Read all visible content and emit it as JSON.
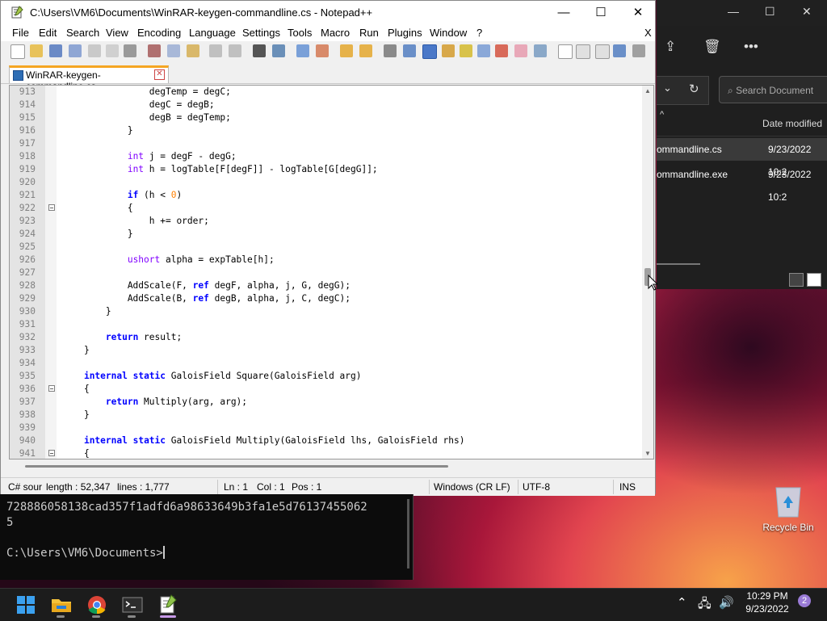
{
  "window": {
    "title": "C:\\Users\\VM6\\Documents\\WinRAR-keygen-commandline.cs - Notepad++",
    "minimize": "—",
    "maximize": "☐",
    "close": "✕",
    "menu_close": "X"
  },
  "menu": [
    "File",
    "Edit",
    "Search",
    "View",
    "Encoding",
    "Language",
    "Settings",
    "Tools",
    "Macro",
    "Run",
    "Plugins",
    "Window",
    "?"
  ],
  "tab": {
    "label": "WinRAR-keygen-commandline.cs"
  },
  "code_lines": [
    {
      "n": "913",
      "t": "                degTemp = degC;"
    },
    {
      "n": "914",
      "t": "                degC = degB;"
    },
    {
      "n": "915",
      "t": "                degB = degTemp;"
    },
    {
      "n": "916",
      "t": "            }"
    },
    {
      "n": "917",
      "t": ""
    },
    {
      "n": "918",
      "t": "            int j = degF - degG;"
    },
    {
      "n": "919",
      "t": "            int h = logTable[F[degF]] - logTable[G[degG]];"
    },
    {
      "n": "920",
      "t": ""
    },
    {
      "n": "921",
      "t": "            if (h < 0)"
    },
    {
      "n": "922",
      "t": "            {"
    },
    {
      "n": "923",
      "t": "                h += order;"
    },
    {
      "n": "924",
      "t": "            }"
    },
    {
      "n": "925",
      "t": ""
    },
    {
      "n": "926",
      "t": "            ushort alpha = expTable[h];"
    },
    {
      "n": "927",
      "t": ""
    },
    {
      "n": "928",
      "t": "            AddScale(F, ref degF, alpha, j, G, degG);"
    },
    {
      "n": "929",
      "t": "            AddScale(B, ref degB, alpha, j, C, degC);"
    },
    {
      "n": "930",
      "t": "        }"
    },
    {
      "n": "931",
      "t": ""
    },
    {
      "n": "932",
      "t": "        return result;"
    },
    {
      "n": "933",
      "t": "    }"
    },
    {
      "n": "934",
      "t": ""
    },
    {
      "n": "935",
      "t": "    internal static GaloisField Square(GaloisField arg)"
    },
    {
      "n": "936",
      "t": "    {"
    },
    {
      "n": "937",
      "t": "        return Multiply(arg, arg);"
    },
    {
      "n": "938",
      "t": "    }"
    },
    {
      "n": "939",
      "t": ""
    },
    {
      "n": "940",
      "t": "    internal static GaloisField Multiply(GaloisField lhs, GaloisField rhs)"
    },
    {
      "n": "941",
      "t": "    {"
    }
  ],
  "fold_lines": [
    "922",
    "936",
    "941"
  ],
  "status": {
    "lang": "C# sour",
    "length": "length : 52,347",
    "lines": "lines : 1,777",
    "ln": "Ln : 1",
    "col": "Col : 1",
    "pos": "Pos : 1",
    "eol": "Windows (CR LF)",
    "enc": "UTF-8",
    "mode": "INS"
  },
  "terminal": {
    "line1": "728886058138cad357f1adfd6a98633649b3fa1e5d76137455062",
    "line2": "5",
    "prompt": "C:\\Users\\VM6\\Documents>"
  },
  "explorer": {
    "search_placeholder": "Search Document",
    "col_date": "Date modified",
    "files": [
      {
        "name": "ommandline.cs",
        "date": "9/23/2022 10:2"
      },
      {
        "name": "ommandline.exe",
        "date": "9/23/2022 10:2"
      }
    ],
    "more": "•••"
  },
  "desktop": {
    "recycle_bin": "Recycle Bin"
  },
  "taskbar": {
    "time": "10:29 PM",
    "date": "9/23/2022",
    "badge": "2"
  },
  "colors": {
    "keyword": "#0000ff",
    "type": "#8000ff",
    "number": "#ff8000",
    "tab_accent": "#f5a623",
    "taskbar": "#1c1c1c",
    "terminal_bg": "#0c0c0c"
  }
}
